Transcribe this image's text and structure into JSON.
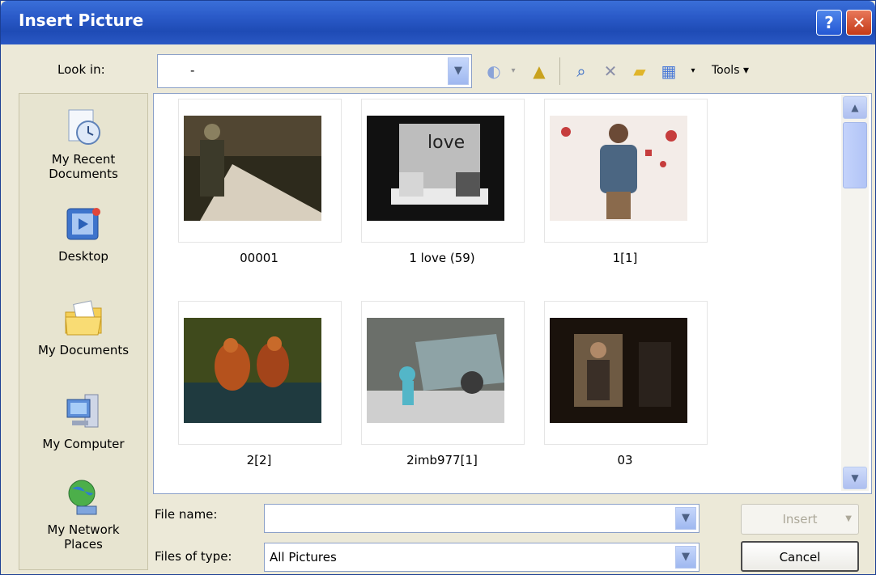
{
  "window": {
    "title": "Insert Picture"
  },
  "toolbar": {
    "look_in_label": "Look in:",
    "look_in_value": "-",
    "tools_label": "Tools ▾"
  },
  "places": [
    {
      "label_line1": "My Recent",
      "label_line2": "Documents"
    },
    {
      "label_line1": "Desktop",
      "label_line2": ""
    },
    {
      "label_line1": "My Documents",
      "label_line2": ""
    },
    {
      "label_line1": "My Computer",
      "label_line2": ""
    },
    {
      "label_line1": "My Network",
      "label_line2": "Places"
    }
  ],
  "files": [
    {
      "name": "00001",
      "thumb_colors": [
        "#2d2a1c",
        "#6a5b3e",
        "#d8cfbe"
      ]
    },
    {
      "name": "1 love (59)",
      "thumb_colors": [
        "#1a1a1a",
        "#bdbdbd",
        "#eaeaea"
      ]
    },
    {
      "name": "1[1]",
      "thumb_colors": [
        "#f3ece8",
        "#4b6682",
        "#c63d3d"
      ]
    },
    {
      "name": "2[2]",
      "thumb_colors": [
        "#3f4a1c",
        "#b5521d",
        "#1f3a3f"
      ]
    },
    {
      "name": "2imb977[1]",
      "thumb_colors": [
        "#6b6f6a",
        "#8ea3a6",
        "#53b6c8"
      ]
    },
    {
      "name": "03",
      "thumb_colors": [
        "#1a120c",
        "#6e5a43",
        "#3a2f27"
      ]
    }
  ],
  "form": {
    "file_name_label": "File name:",
    "file_name_value": "",
    "files_of_type_label": "Files of type:",
    "files_of_type_value": "All Pictures"
  },
  "buttons": {
    "insert_label": "Insert",
    "cancel_label": "Cancel"
  }
}
